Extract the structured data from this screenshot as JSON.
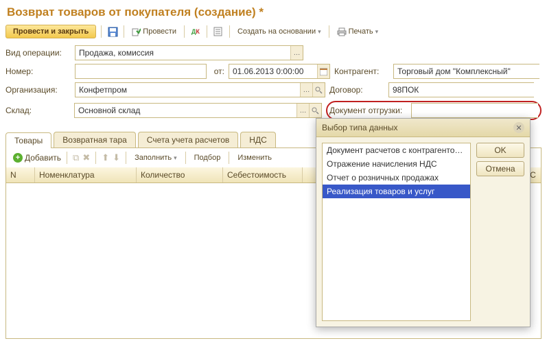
{
  "title": "Возврат товаров от покупателя (создание) *",
  "toolbar": {
    "submit": "Провести и закрыть",
    "provesti": "Провести",
    "create_on_basis": "Создать на основании",
    "print": "Печать"
  },
  "labels": {
    "operation": "Вид операции:",
    "number": "Номер:",
    "from": "от:",
    "organization": "Организация:",
    "warehouse": "Склад:",
    "counterparty": "Контрагент:",
    "contract": "Договор:",
    "shipdoc": "Документ отгрузки:"
  },
  "fields": {
    "operation": "Продажа, комиссия",
    "number": "",
    "date": "01.06.2013 0:00:00",
    "organization": "Конфетпром",
    "warehouse": "Основной склад",
    "counterparty": "Торговый дом \"Комплексный\"",
    "contract": "98ПОК",
    "shipdoc": ""
  },
  "tabs": {
    "goods": "Товары",
    "tara": "Возвратная тара",
    "accounts": "Счета учета расчетов",
    "vat": "НДС"
  },
  "tabToolbar": {
    "add": "Добавить",
    "fill": "Заполнить",
    "select": "Подбор",
    "change": "Изменить"
  },
  "grid": {
    "n": "N",
    "nomenclature": "Номенклатура",
    "qty": "Количество",
    "cost": "Себестоимость",
    "vat": "ДС"
  },
  "dialog": {
    "title": "Выбор типа данных",
    "ok": "OK",
    "cancel": "Отмена",
    "items": [
      "Документ расчетов с контрагентом (...",
      "Отражение начисления НДС",
      "Отчет о розничных продажах",
      "Реализация товаров и услуг"
    ],
    "selected": 3
  }
}
